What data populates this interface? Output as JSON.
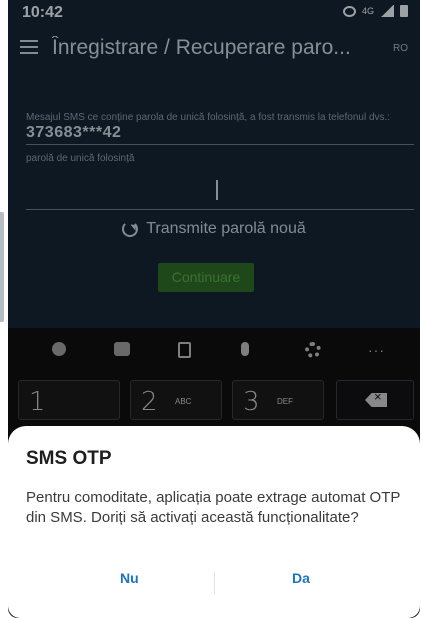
{
  "status_bar": {
    "time": "10:42",
    "icons": [
      "alarm-icon",
      "network-type-icon",
      "signal-icon",
      "battery-icon"
    ],
    "network_label": "4G"
  },
  "app_bar": {
    "title": "Înregistrare / Recuperare paro...",
    "language": "RO"
  },
  "form": {
    "sms_message": "Mesajul SMS ce conține parola de unică folosință, a fost transmis la telefonul dvs.:",
    "phone_masked": "373683***42",
    "otp_label": "parolă de unică folosință",
    "otp_value": "",
    "resend_label": "Transmite parolă nouă",
    "continue_label": "Continuare"
  },
  "keyboard": {
    "toolbar": [
      "emoji-icon",
      "sticker-icon",
      "clipboard-icon",
      "microphone-icon",
      "settings-icon",
      "more-icon"
    ],
    "more_label": "···",
    "keys": [
      {
        "num": "1",
        "sub": ""
      },
      {
        "num": "2",
        "sub": "ABC"
      },
      {
        "num": "3",
        "sub": "DEF"
      }
    ]
  },
  "dialog": {
    "title": "SMS OTP",
    "message": "Pentru comoditate, aplicația poate extrage automat OTP din SMS. Doriți să activați această funcționalitate?",
    "no_label": "Nu",
    "yes_label": "Da"
  },
  "colors": {
    "background": "#142433",
    "continue_button": "#2f6b27",
    "dialog_accent": "#1c73c4"
  }
}
